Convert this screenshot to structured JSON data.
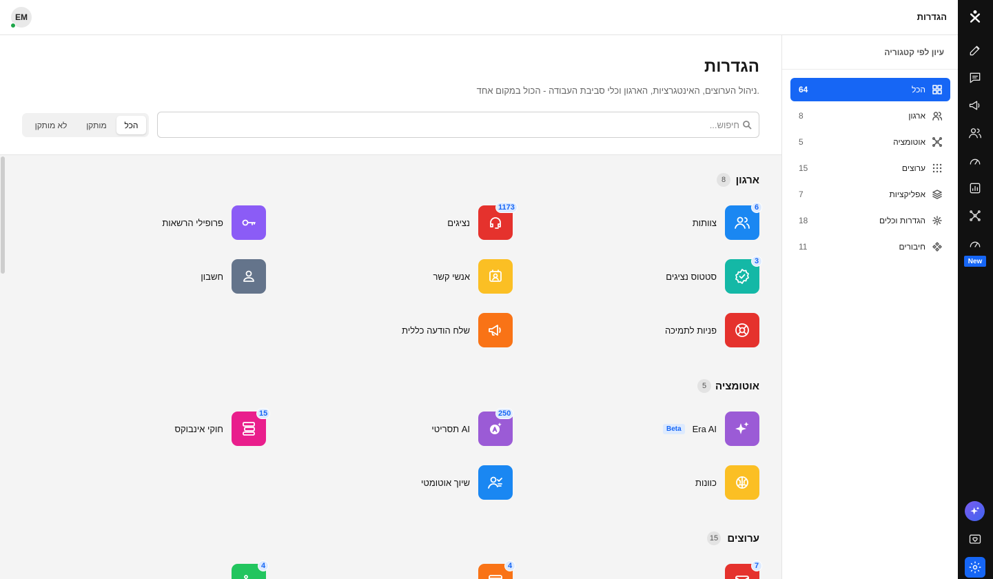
{
  "topbar": {
    "title": "הגדרות",
    "avatar_initials": "EM"
  },
  "rail": {
    "new_badge": "New"
  },
  "categories": {
    "heading": "עיון לפי קטגוריה",
    "items": [
      {
        "label": "הכל",
        "count": "64",
        "icon": "grid-icon",
        "active": true
      },
      {
        "label": "ארגון",
        "count": "8",
        "icon": "users-icon"
      },
      {
        "label": "אוטומציה",
        "count": "5",
        "icon": "nodes-icon"
      },
      {
        "label": "ערוצים",
        "count": "15",
        "icon": "dots-grid-icon"
      },
      {
        "label": "אפליקציות",
        "count": "7",
        "icon": "layers-icon"
      },
      {
        "label": "הגדרות וכלים",
        "count": "18",
        "icon": "gear-icon"
      },
      {
        "label": "חיבורים",
        "count": "11",
        "icon": "connect-icon"
      }
    ]
  },
  "header": {
    "title": "הגדרות",
    "subtitle": "ניהול הערוצים, האינטגרציות, הארגון וכלי סביבת העבודה - הכול במקום אחד.",
    "search_placeholder": "חיפוש...",
    "filters": [
      "הכל",
      "מותקן",
      "לא מותקן"
    ]
  },
  "sections": [
    {
      "title": "ארגון",
      "count": "8",
      "cards": [
        {
          "label": "צוותות",
          "badge": "6",
          "color": "#1a87f2",
          "icon": "team-icon"
        },
        {
          "label": "נציגים",
          "badge": "1173",
          "color": "#e5322d",
          "icon": "headset-icon"
        },
        {
          "label": "פרופילי הרשאות",
          "color": "#8b5cf6",
          "icon": "key-icon"
        },
        {
          "label": "סטטוס נציגים",
          "badge": "3",
          "color": "#14b8a6",
          "icon": "badge-check-icon"
        },
        {
          "label": "אנשי קשר",
          "color": "#fbbf24",
          "icon": "contact-card-icon"
        },
        {
          "label": "חשבון",
          "color": "#64748b",
          "icon": "user-icon"
        },
        {
          "label": "פניות לתמיכה",
          "color": "#e5322d",
          "icon": "lifebuoy-icon"
        },
        {
          "label": "שלח הודעה כללית",
          "color": "#f97316",
          "icon": "megaphone-icon"
        }
      ]
    },
    {
      "title": "אוטומציה",
      "count": "5",
      "cards": [
        {
          "label": "Era AI",
          "tag": "Beta",
          "color": "#9b5bd6",
          "icon": "sparkles-icon"
        },
        {
          "label": "תסריטי AI",
          "badge": "250",
          "color": "#9b5bd6",
          "icon": "ai-script-icon"
        },
        {
          "label": "חוקי אינבוקס",
          "badge": "15",
          "color": "#e91e8c",
          "icon": "inbox-rules-icon"
        },
        {
          "label": "כוונות",
          "color": "#fbbf24",
          "icon": "brain-icon"
        },
        {
          "label": "שיוך אוטומטי",
          "color": "#1a87f2",
          "icon": "user-check-icon"
        }
      ]
    },
    {
      "title": "ערוצים",
      "count": "15",
      "cards": [
        {
          "label": "",
          "badge": "7",
          "color": "#e5322d",
          "icon": "mail-icon"
        },
        {
          "label": "",
          "badge": "4",
          "color": "#f97316",
          "icon": "window-icon"
        },
        {
          "label": "",
          "badge": "4",
          "color": "#22c55e",
          "icon": "flow-icon"
        }
      ]
    }
  ]
}
